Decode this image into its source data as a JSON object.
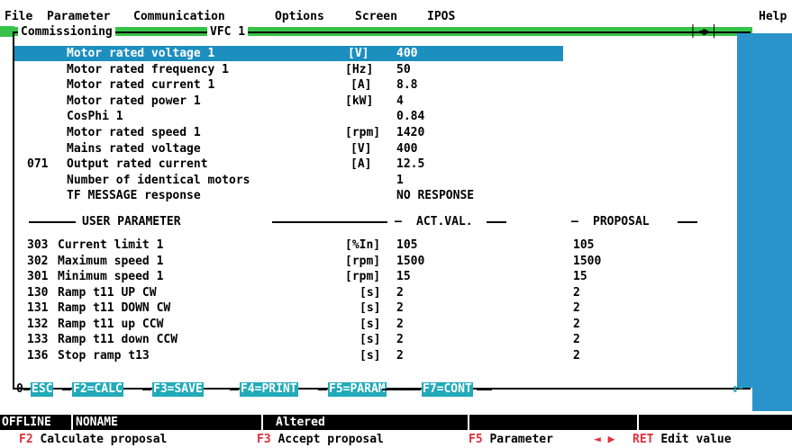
{
  "menu": {
    "items": [
      "File",
      "Parameter",
      "Communication",
      "Options",
      "Screen",
      "IPOS"
    ],
    "help": "Help"
  },
  "window": {
    "title": "Commissioning",
    "subtitle": "VFC 1",
    "controls": "◄▶"
  },
  "motor_rows": [
    {
      "num": "",
      "name": "Motor rated voltage 1",
      "unit": "[V]",
      "value": "400",
      "selected": true
    },
    {
      "num": "",
      "name": "Motor rated frequency 1",
      "unit": "[Hz]",
      "value": "50"
    },
    {
      "num": "",
      "name": "Motor rated current 1",
      "unit": "[A]",
      "value": "8.8"
    },
    {
      "num": "",
      "name": "Motor rated power 1",
      "unit": "[kW]",
      "value": "4"
    },
    {
      "num": "",
      "name": "CosPhi 1",
      "unit": "",
      "value": "0.84"
    },
    {
      "num": "",
      "name": "Motor rated speed 1",
      "unit": "[rpm]",
      "value": "1420"
    },
    {
      "num": "",
      "name": "Mains rated voltage",
      "unit": "[V]",
      "value": "400"
    },
    {
      "num": "071",
      "name": "Output rated current",
      "unit": "[A]",
      "value": "12.5"
    },
    {
      "num": "",
      "name": "Number of identical motors",
      "unit": "",
      "value": "1"
    },
    {
      "num": "",
      "name": "TF MESSAGE response",
      "unit": "",
      "value": "NO RESPONSE"
    }
  ],
  "section_headers": {
    "user": "USER PARAMETER",
    "actual": "ACT.VAL.",
    "proposal": "PROPOSAL"
  },
  "user_rows": [
    {
      "num": "303",
      "name": "Current limit 1",
      "unit": "[%In]",
      "value": "105",
      "proposal": "105"
    },
    {
      "num": "302",
      "name": "Maximum speed 1",
      "unit": "[rpm]",
      "value": "1500",
      "proposal": "1500"
    },
    {
      "num": "301",
      "name": "Minimum speed 1",
      "unit": "[rpm]",
      "value": "15",
      "proposal": "15"
    },
    {
      "num": "130",
      "name": "Ramp t11 UP CW",
      "unit": "[s]",
      "value": "2",
      "proposal": "2"
    },
    {
      "num": "131",
      "name": "Ramp t11 DOWN CW",
      "unit": "[s]",
      "value": "2",
      "proposal": "2"
    },
    {
      "num": "132",
      "name": "Ramp t11 up CCW",
      "unit": "[s]",
      "value": "2",
      "proposal": "2"
    },
    {
      "num": "133",
      "name": "Ramp t11 down CCW",
      "unit": "[s]",
      "value": "2",
      "proposal": "2"
    },
    {
      "num": "136",
      "name": "Stop ramp t13",
      "unit": "[s]",
      "value": "2",
      "proposal": "2"
    }
  ],
  "function_keys": {
    "prefix": "0",
    "keys": [
      "ESC",
      "F2=CALC",
      "F3=SAVE",
      "F4=PRINT",
      "F5=PARAM",
      "F7=CONT"
    ]
  },
  "status": {
    "mode": "OFFLINE",
    "file": "NONAME",
    "state": "Altered"
  },
  "hints": [
    {
      "key": "F2",
      "text": "Calculate proposal"
    },
    {
      "key": "F3",
      "text": "Accept proposal"
    },
    {
      "key": "F5",
      "text": "Parameter"
    },
    {
      "key": "◄ ▶",
      "text": ""
    },
    {
      "key": "RET",
      "text": "Edit value"
    }
  ],
  "colors": {
    "selection": "#1d8fbf",
    "fkey": "#22aab8",
    "accent_green": "#38c24a",
    "hint_key": "#e0303a",
    "strip": "#2a93c9"
  }
}
